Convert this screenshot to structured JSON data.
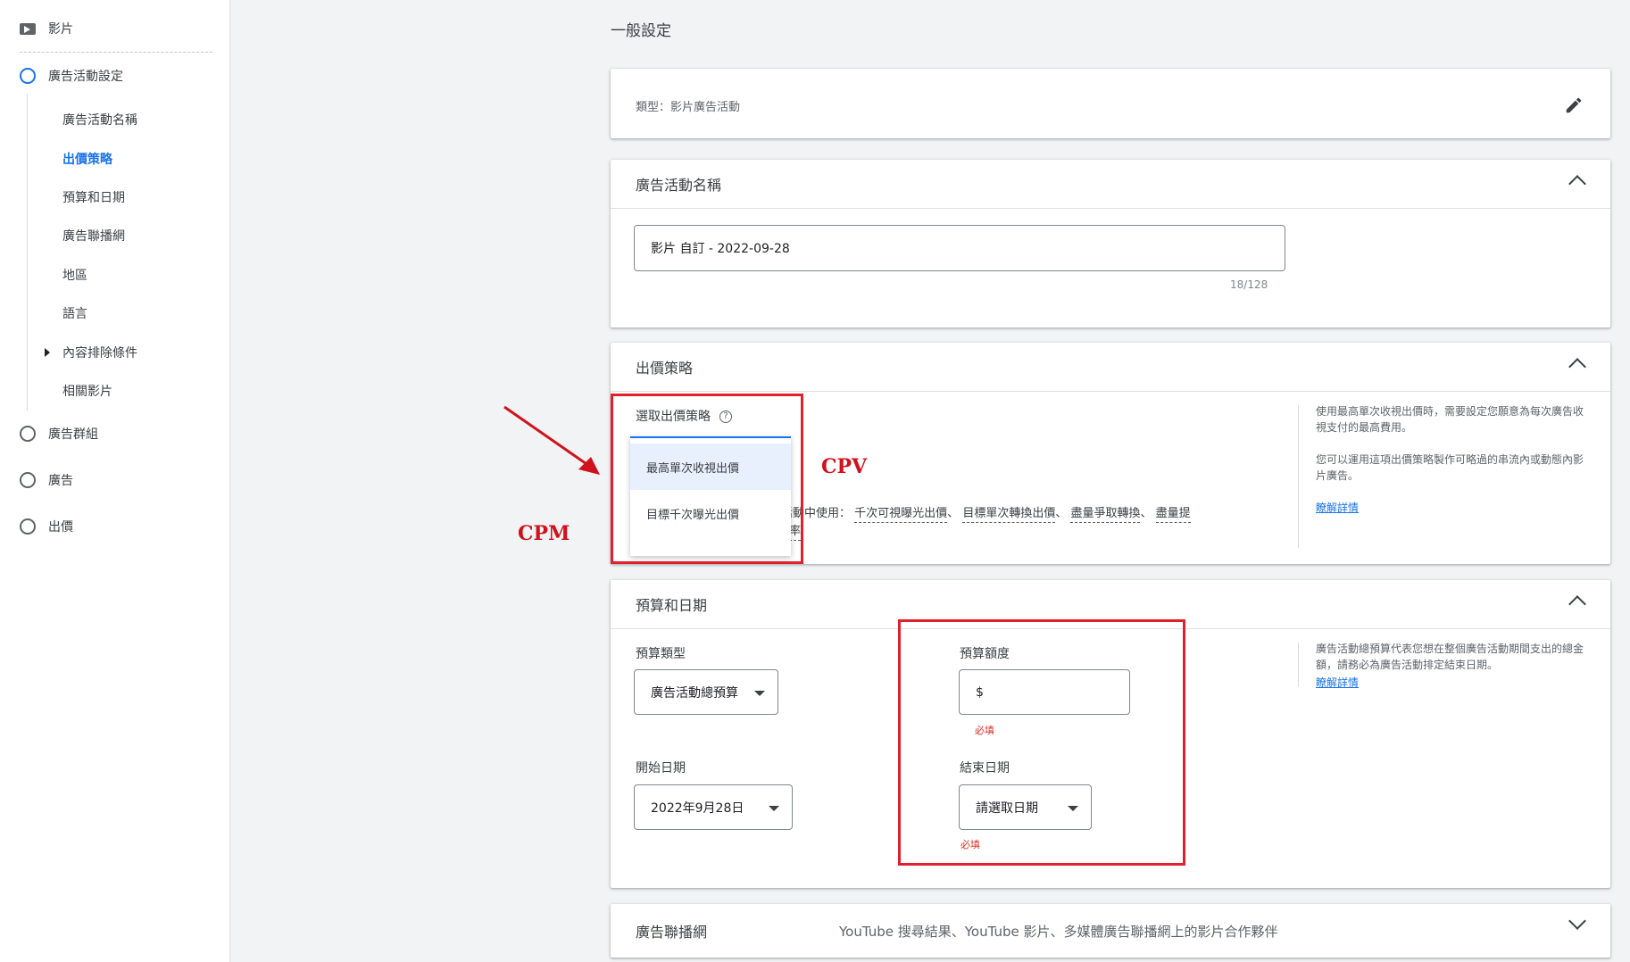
{
  "sidebar": {
    "video_label": "影片",
    "steps": {
      "campaign_settings": "廣告活動設定",
      "ad_group": "廣告群組",
      "ads": "廣告",
      "bid": "出價"
    },
    "sub_items": [
      "廣告活動名稱",
      "出價策略",
      "預算和日期",
      "廣告聯播網",
      "地區",
      "語言",
      "內容排除條件",
      "相關影片"
    ]
  },
  "main": {
    "title": "一般設定",
    "type_card": {
      "text": "類型：影片廣告活動"
    },
    "name_card": {
      "title": "廣告活動名稱",
      "value": "影片 自訂 - 2022-09-28",
      "counter": "18/128"
    },
    "bid_card": {
      "title": "出價策略",
      "select_label": "選取出價策略",
      "help_icon": "?",
      "options": [
        "最高單次收視出價",
        "目標千次曝光出價"
      ],
      "partial_text_prefix": "告活動中使用：",
      "partial_links": [
        "千次可視曝光出價",
        "目標單次轉換出價",
        "盡量爭取轉換",
        "盡量提"
      ],
      "partial_text_line2": "率",
      "help_text1": "使用最高單次收視出價時，需要設定您願意為每次廣告收視支付的最高費用。",
      "help_text2": "您可以運用這項出價策略製作可略過的串流內或動態內影片廣告。",
      "learn_more": "瞭解詳情"
    },
    "budget_card": {
      "title": "預算和日期",
      "budget_type_label": "預算類型",
      "budget_type_value": "廣告活動總預算",
      "budget_amount_label": "預算額度",
      "currency": "$",
      "required": "必填",
      "start_label": "開始日期",
      "start_value": "2022年9月28日",
      "end_label": "結束日期",
      "end_value": "請選取日期",
      "help_text": "廣告活動總預算代表您想在整個廣告活動期間支出的總金額，請務必為廣告活動排定結束日期。",
      "learn_more": "瞭解詳情"
    },
    "network_card": {
      "title": "廣告聯播網",
      "summary": "YouTube 搜尋結果、YouTube 影片、多媒體廣告聯播網上的影片合作夥伴"
    }
  },
  "annotations": {
    "cpv": "CPV",
    "cpm": "CPM",
    "color": "#d0121d"
  },
  "colors": {
    "accent": "#1a73e8",
    "error": "#d93025",
    "highlight_box": "#e0202e"
  }
}
